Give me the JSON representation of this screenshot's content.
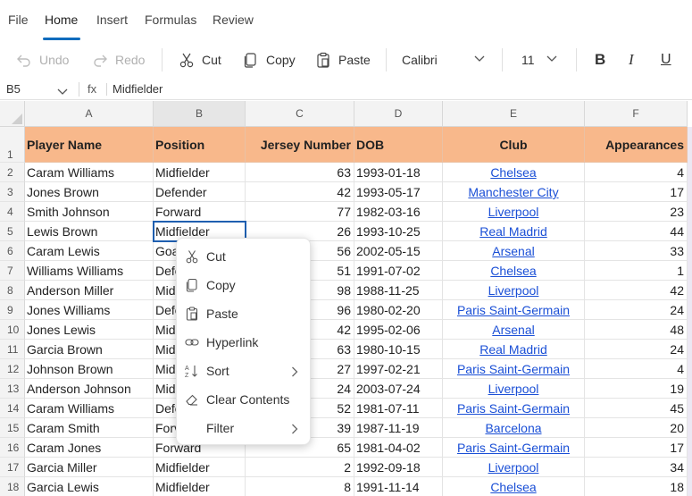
{
  "ribbon": {
    "tabs": [
      {
        "label": "File",
        "active": false
      },
      {
        "label": "Home",
        "active": true
      },
      {
        "label": "Insert",
        "active": false
      },
      {
        "label": "Formulas",
        "active": false
      },
      {
        "label": "Review",
        "active": false
      }
    ]
  },
  "toolbar": {
    "undo_label": "Undo",
    "redo_label": "Redo",
    "cut_label": "Cut",
    "copy_label": "Copy",
    "paste_label": "Paste",
    "font_name": "Calibri",
    "font_size": "11",
    "bold_glyph": "B",
    "italic_glyph": "I",
    "underline_glyph": "U"
  },
  "formula_bar": {
    "name_box": "B5",
    "fx_label": "fx",
    "value": "Midfielder"
  },
  "sheet": {
    "columns": [
      "A",
      "B",
      "C",
      "D",
      "E",
      "F"
    ],
    "selected_column": "B",
    "header_row": [
      "Player Name",
      "Position",
      "Jersey Number",
      "DOB",
      "Club",
      "Appearances"
    ],
    "rows": [
      {
        "num": "2",
        "cells": [
          "Caram Williams",
          "Midfielder",
          "63",
          "1993-01-18",
          "Chelsea",
          "4"
        ]
      },
      {
        "num": "3",
        "cells": [
          "Jones Brown",
          "Defender",
          "42",
          "1993-05-17",
          "Manchester City",
          "17"
        ]
      },
      {
        "num": "4",
        "cells": [
          "Smith Johnson",
          "Forward",
          "77",
          "1982-03-16",
          "Liverpool",
          "23"
        ]
      },
      {
        "num": "5",
        "cells": [
          "Lewis Brown",
          "Midfielder",
          "26",
          "1993-10-25",
          "Real Madrid",
          "44"
        ]
      },
      {
        "num": "6",
        "cells": [
          "Caram Lewis",
          "Goa",
          "56",
          "2002-05-15",
          "Arsenal",
          "33"
        ]
      },
      {
        "num": "7",
        "cells": [
          "Williams Williams",
          "Defe",
          "51",
          "1991-07-02",
          "Chelsea",
          "1"
        ]
      },
      {
        "num": "8",
        "cells": [
          "Anderson Miller",
          "Mid",
          "98",
          "1988-11-25",
          "Liverpool",
          "42"
        ]
      },
      {
        "num": "9",
        "cells": [
          "Jones Williams",
          "Defe",
          "96",
          "1980-02-20",
          "Paris Saint-Germain",
          "24"
        ]
      },
      {
        "num": "10",
        "cells": [
          "Jones Lewis",
          "Mid",
          "42",
          "1995-02-06",
          "Arsenal",
          "48"
        ]
      },
      {
        "num": "11",
        "cells": [
          "Garcia Brown",
          "Mid",
          "63",
          "1980-10-15",
          "Real Madrid",
          "24"
        ]
      },
      {
        "num": "12",
        "cells": [
          "Johnson Brown",
          "Mid",
          "27",
          "1997-02-21",
          "Paris Saint-Germain",
          "4"
        ]
      },
      {
        "num": "13",
        "cells": [
          "Anderson Johnson",
          "Mid",
          "24",
          "2003-07-24",
          "Liverpool",
          "19"
        ]
      },
      {
        "num": "14",
        "cells": [
          "Caram Williams",
          "Defe",
          "52",
          "1981-07-11",
          "Paris Saint-Germain",
          "45"
        ]
      },
      {
        "num": "15",
        "cells": [
          "Caram Smith",
          "Forv",
          "39",
          "1987-11-19",
          "Barcelona",
          "20"
        ]
      },
      {
        "num": "16",
        "cells": [
          "Caram Jones",
          "Forward",
          "65",
          "1981-04-02",
          "Paris Saint-Germain",
          "17"
        ]
      },
      {
        "num": "17",
        "cells": [
          "Garcia Miller",
          "Midfielder",
          "2",
          "1992-09-18",
          "Liverpool",
          "34"
        ]
      },
      {
        "num": "18",
        "cells": [
          "Garcia Lewis",
          "Midfielder",
          "8",
          "1991-11-14",
          "Chelsea",
          "18"
        ]
      }
    ],
    "header_row_num": "1",
    "header_fill": "#f8b88b",
    "link_color": "#1a4fd6"
  },
  "context_menu": {
    "items": [
      {
        "label": "Cut",
        "icon": "scissors-icon",
        "submenu": false
      },
      {
        "label": "Copy",
        "icon": "copy-icon",
        "submenu": false
      },
      {
        "label": "Paste",
        "icon": "clipboard-icon",
        "submenu": false
      },
      {
        "label": "Hyperlink",
        "icon": "link-icon",
        "submenu": false
      },
      {
        "label": "Sort",
        "icon": "sort-icon",
        "submenu": true
      },
      {
        "label": "Clear Contents",
        "icon": "eraser-icon",
        "submenu": false
      },
      {
        "label": "Filter",
        "icon": "",
        "submenu": true
      }
    ]
  },
  "colors": {
    "accent": "#0f6cbd",
    "selection": "#1f5fb0"
  }
}
